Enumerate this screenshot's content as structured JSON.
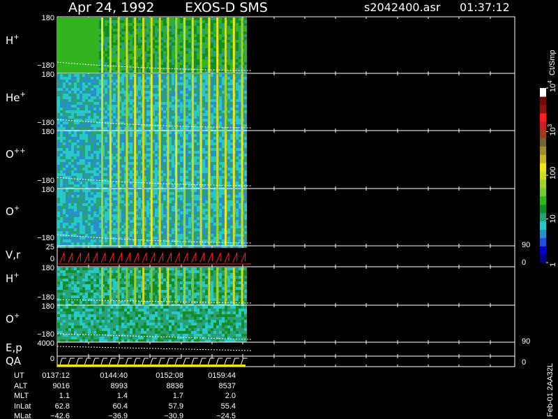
{
  "header": {
    "date": "Apr 24, 1992",
    "instrument": "EXOS-D SMS",
    "file": "s2042400.asr",
    "time": "01:37:12"
  },
  "chart_data": {
    "type": "heatmap",
    "title": "Apr 24, 1992 EXOS-D SMS",
    "panels": [
      {
        "species": "H",
        "charge": "+",
        "ylim": [
          -180,
          180
        ],
        "ytop": "180",
        "ybot": "−180"
      },
      {
        "species": "He",
        "charge": "+",
        "ylim": [
          -180,
          180
        ],
        "ytop": "180",
        "ybot": "−180"
      },
      {
        "species": "O",
        "charge": "++",
        "ylim": [
          -180,
          180
        ],
        "ytop": "180",
        "ybot": "−180"
      },
      {
        "species": "O",
        "charge": "+",
        "ylim": [
          -180,
          180
        ],
        "ytop": "180",
        "ybot": "−180"
      },
      {
        "species": "V,r",
        "charge": "",
        "ylim": [
          0,
          25
        ],
        "ytop": "25",
        "ybot": "0",
        "right_top": "90",
        "right_bot": "0"
      },
      {
        "species": "H",
        "charge": "+",
        "ylim": [
          -180,
          180
        ],
        "ytop": "180",
        "ybot": "−180"
      },
      {
        "species": "O",
        "charge": "+",
        "ylim": [
          -180,
          180
        ],
        "ytop": "180",
        "ybot": "−180"
      },
      {
        "species": "E,p",
        "charge": "",
        "ylim": [
          0,
          4000
        ],
        "ytop": "4000",
        "ybot": "",
        "right_top": "90",
        "right_bot": ""
      },
      {
        "species": "QA",
        "charge": "",
        "ylim": [
          0,
          1
        ],
        "ytop": "",
        "ybot": "0",
        "right_top": "",
        "right_bot": "0"
      }
    ],
    "colorbar": {
      "label": "Ct/Smp",
      "scale": "log",
      "range": [
        1,
        10000
      ],
      "tick_labels": [
        "1",
        "10",
        "100",
        "10",
        "10"
      ],
      "tick_exponents": [
        "",
        "",
        "",
        "3",
        "4"
      ],
      "colors": [
        "#000080",
        "#0000c8",
        "#1e50dc",
        "#2890c8",
        "#28c8c8",
        "#28a078",
        "#148c28",
        "#32b41e",
        "#78c83c",
        "#a0d228",
        "#d2dc1e",
        "#f0e614",
        "#c8b428",
        "#a08c28",
        "#786432",
        "#a03c1e",
        "#c81e1e",
        "#ff1e1e",
        "#8c1414",
        "#6e0a0a",
        "#ffffff"
      ]
    },
    "orbit": {
      "rows": [
        "UT",
        "ALT",
        "MLT",
        "InLat",
        "MLat"
      ],
      "columns": [
        [
          "0137:12",
          "9016",
          "1.1",
          "62.8",
          "−42.6"
        ],
        [
          "0144:40",
          "8993",
          "1.4",
          "60.4",
          "−36.9"
        ],
        [
          "0152:08",
          "8836",
          "1.7",
          "57.9",
          "−30.9"
        ],
        [
          "0159:44",
          "8537",
          "2.0",
          "55.4",
          "−24.5"
        ]
      ]
    },
    "stamp": "Feb-01 2AA32L"
  }
}
